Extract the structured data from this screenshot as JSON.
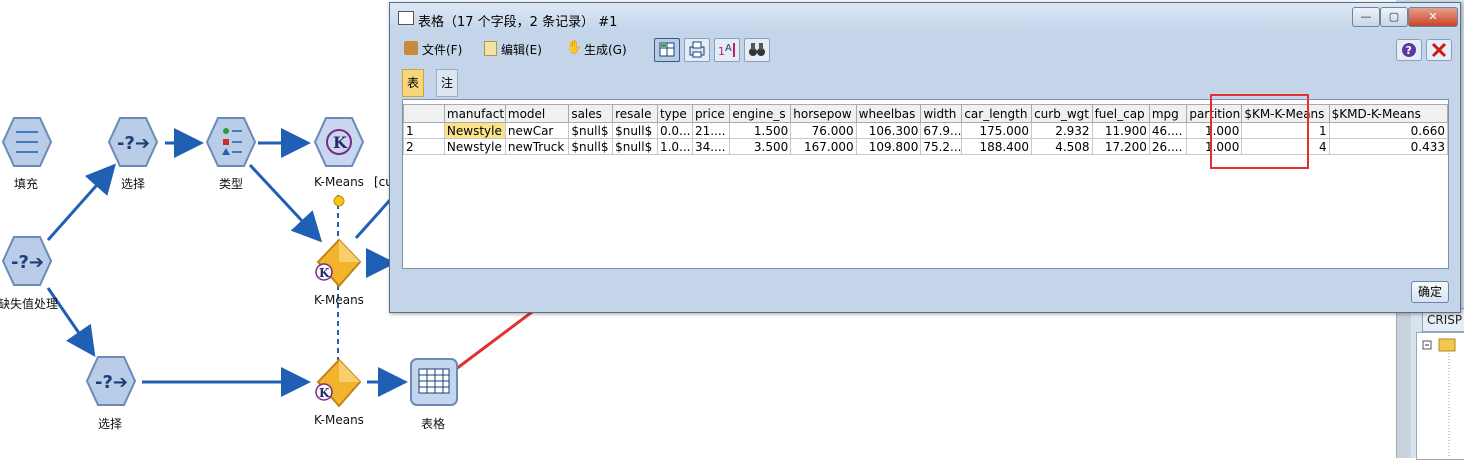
{
  "canvas": {
    "nodes": [
      {
        "label": "填充",
        "icon": "fill-node-icon"
      },
      {
        "label": "选择",
        "icon": "select-node-icon"
      },
      {
        "label": "类型",
        "icon": "type-node-icon"
      },
      {
        "label": "K-Means",
        "icon": "kmeans-model-node-icon"
      },
      {
        "label": "[cu",
        "icon": ""
      },
      {
        "label": "缺失值处理",
        "icon": "missing-value-node-icon"
      },
      {
        "label": "K-Means",
        "icon": "kmeans-nugget-icon"
      },
      {
        "label": "选择",
        "icon": "select-node-icon"
      },
      {
        "label": "K-Means",
        "icon": "kmeans-nugget-icon"
      },
      {
        "label": "表格",
        "icon": "table-node-icon"
      }
    ]
  },
  "right_panel": {
    "tab_label": "CRISP"
  },
  "window": {
    "title": "表格（17 个字段，2 条记录） #1",
    "menu": {
      "file": "文件(F)",
      "edit": "编辑(E)",
      "generate": "生成(G)"
    },
    "tabs": [
      "表格",
      "注解"
    ],
    "ok_label": "确定"
  },
  "table": {
    "columns": [
      "",
      "manufact",
      "model",
      "sales",
      "resale",
      "type",
      "price",
      "engine_s",
      "horsepow",
      "wheelbas",
      "width",
      "car_length",
      "curb_wgt",
      "fuel_cap",
      "mpg",
      "partition",
      "$KM-K-Means",
      "$KMD-K-Means"
    ],
    "rows": [
      [
        "1",
        "Newstyle",
        "newCar",
        "$null$",
        "$null$",
        "0.0...",
        "21....",
        "1.500",
        "76.000",
        "106.300",
        "67.9...",
        "175.000",
        "2.932",
        "11.900",
        "46....",
        "1.000",
        "1",
        "0.660"
      ],
      [
        "2",
        "Newstyle",
        "newTruck",
        "$null$",
        "$null$",
        "1.0...",
        "34....",
        "3.500",
        "167.000",
        "109.800",
        "75.2...",
        "188.400",
        "4.508",
        "17.200",
        "26....",
        "1.000",
        "4",
        "0.433"
      ]
    ]
  },
  "colors": {
    "accent": "#1f5fb4",
    "highlight": "#e03030",
    "tab_active": "#f7d77a"
  }
}
